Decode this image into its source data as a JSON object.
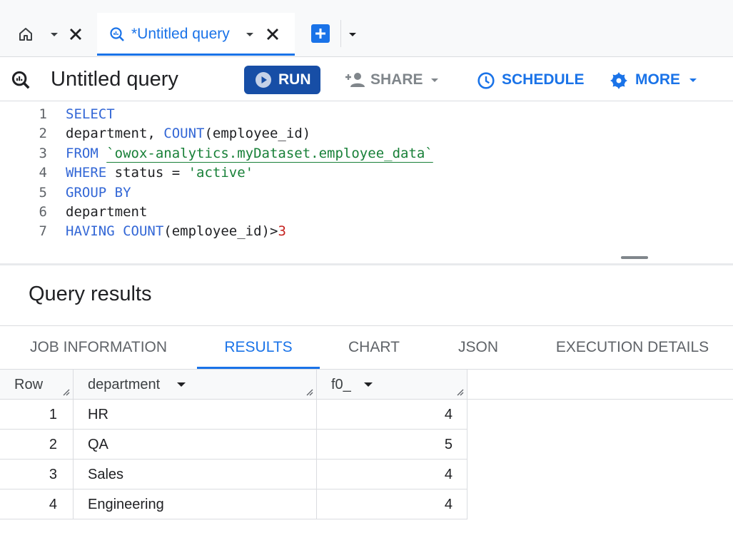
{
  "tabs": {
    "query_tab_label": "*Untitled query"
  },
  "toolbar": {
    "title": "Untitled query",
    "run_label": "RUN",
    "share_label": "SHARE",
    "schedule_label": "SCHEDULE",
    "more_label": "MORE"
  },
  "editor": {
    "lines": [
      {
        "n": "1",
        "parts": [
          {
            "t": "SELECT",
            "c": "kw"
          }
        ]
      },
      {
        "n": "2",
        "parts": [
          {
            "t": "department, ",
            "c": "tx"
          },
          {
            "t": "COUNT",
            "c": "kw"
          },
          {
            "t": "(employee_id)",
            "c": "tx"
          }
        ]
      },
      {
        "n": "3",
        "parts": [
          {
            "t": "FROM ",
            "c": "kw"
          },
          {
            "t": "`owox-analytics.myDataset.employee_data`",
            "c": "st underline"
          }
        ]
      },
      {
        "n": "4",
        "parts": [
          {
            "t": "WHERE",
            "c": "kw"
          },
          {
            "t": " status = ",
            "c": "tx"
          },
          {
            "t": "'active'",
            "c": "st"
          }
        ]
      },
      {
        "n": "5",
        "parts": [
          {
            "t": "GROUP BY",
            "c": "kw"
          }
        ]
      },
      {
        "n": "6",
        "parts": [
          {
            "t": "department",
            "c": "tx"
          }
        ]
      },
      {
        "n": "7",
        "parts": [
          {
            "t": "HAVING COUNT",
            "c": "kw"
          },
          {
            "t": "(employee_id)>",
            "c": "tx"
          },
          {
            "t": "3",
            "c": "nm"
          }
        ]
      }
    ]
  },
  "results": {
    "title": "Query results",
    "tabs": [
      "JOB INFORMATION",
      "RESULTS",
      "CHART",
      "JSON",
      "EXECUTION DETAILS"
    ],
    "active_tab": "RESULTS",
    "columns": [
      "Row",
      "department",
      "f0_"
    ],
    "rows": [
      {
        "row": "1",
        "department": "HR",
        "f0_": "4"
      },
      {
        "row": "2",
        "department": "QA",
        "f0_": "5"
      },
      {
        "row": "3",
        "department": "Sales",
        "f0_": "4"
      },
      {
        "row": "4",
        "department": "Engineering",
        "f0_": "4"
      }
    ]
  },
  "colors": {
    "accent": "#1a73e8",
    "run_button": "#174ea6",
    "keyword": "#3367d6",
    "string": "#188038",
    "number": "#c5221f"
  },
  "icons": [
    "home-icon",
    "chevron-down-icon",
    "close-icon",
    "query-icon",
    "add-tab-icon",
    "play-icon",
    "person-add-icon",
    "clock-icon",
    "gear-icon",
    "column-resize-icon",
    "sort-down-icon"
  ]
}
